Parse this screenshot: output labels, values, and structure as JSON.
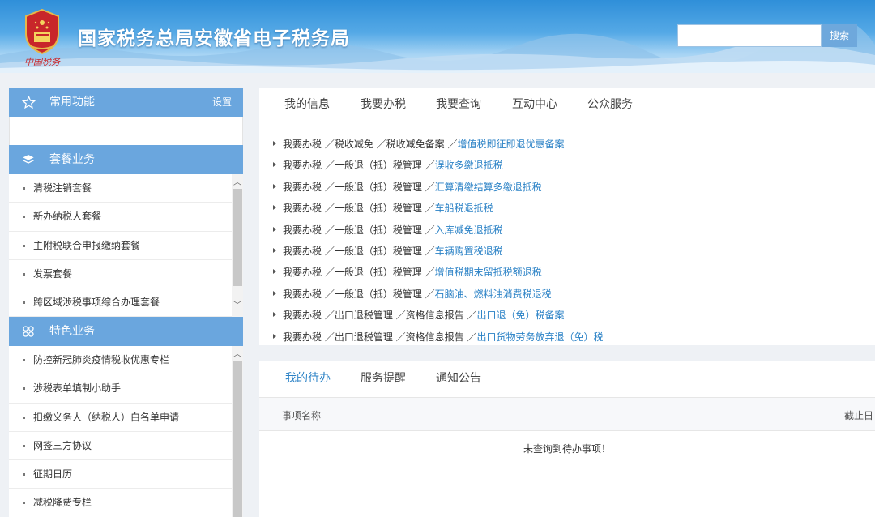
{
  "header": {
    "site_title": "国家税务总局安徽省电子税务局",
    "emblem_script": "中国税务",
    "search": {
      "value": "",
      "button_label": "搜索"
    }
  },
  "sidebar": {
    "common": {
      "title": "常用功能",
      "settings_label": "设置",
      "icon": "star-icon"
    },
    "package": {
      "title": "套餐业务",
      "icon": "layers-icon",
      "items": [
        "清税注销套餐",
        "新办纳税人套餐",
        "主附税联合申报缴纳套餐",
        "发票套餐",
        "跨区域涉税事项综合办理套餐"
      ]
    },
    "special": {
      "title": "特色业务",
      "icon": "grid-icon",
      "items": [
        "防控新冠肺炎疫情税收优惠专栏",
        "涉税表单填制小助手",
        "扣缴义务人（纳税人）白名单申请",
        "网签三方协议",
        "征期日历",
        "减税降费专栏"
      ]
    }
  },
  "main_nav": {
    "tabs": [
      "我的信息",
      "我要办税",
      "我要查询",
      "互动中心",
      "公众服务"
    ]
  },
  "paths": [
    {
      "prefix": "我要办税 ／税收减免 ／税收减免备案 ／",
      "link": "增值税即征即退优惠备案"
    },
    {
      "prefix": "我要办税 ／一般退（抵）税管理 ／",
      "link": "误收多缴退抵税"
    },
    {
      "prefix": "我要办税 ／一般退（抵）税管理 ／",
      "link": "汇算清缴结算多缴退抵税"
    },
    {
      "prefix": "我要办税 ／一般退（抵）税管理 ／",
      "link": "车船税退抵税"
    },
    {
      "prefix": "我要办税 ／一般退（抵）税管理 ／",
      "link": "入库减免退抵税"
    },
    {
      "prefix": "我要办税 ／一般退（抵）税管理 ／",
      "link": "车辆购置税退税"
    },
    {
      "prefix": "我要办税 ／一般退（抵）税管理 ／",
      "link": "增值税期末留抵税额退税"
    },
    {
      "prefix": "我要办税 ／一般退（抵）税管理 ／",
      "link": "石脑油、燃料油消费税退税"
    },
    {
      "prefix": "我要办税 ／出口退税管理 ／资格信息报告 ／",
      "link": "出口退（免）税备案"
    },
    {
      "prefix": "我要办税 ／出口退税管理 ／资格信息报告 ／",
      "link": "出口货物劳务放弃退（免）税"
    }
  ],
  "todo": {
    "tabs": [
      "我的待办",
      "服务提醒",
      "通知公告"
    ],
    "columns": [
      "事项名称",
      "截止日"
    ],
    "empty_message": "未查询到待办事项！"
  },
  "colors": {
    "accent": "#2b82c6",
    "sidebar_header": "#6aa6de"
  }
}
